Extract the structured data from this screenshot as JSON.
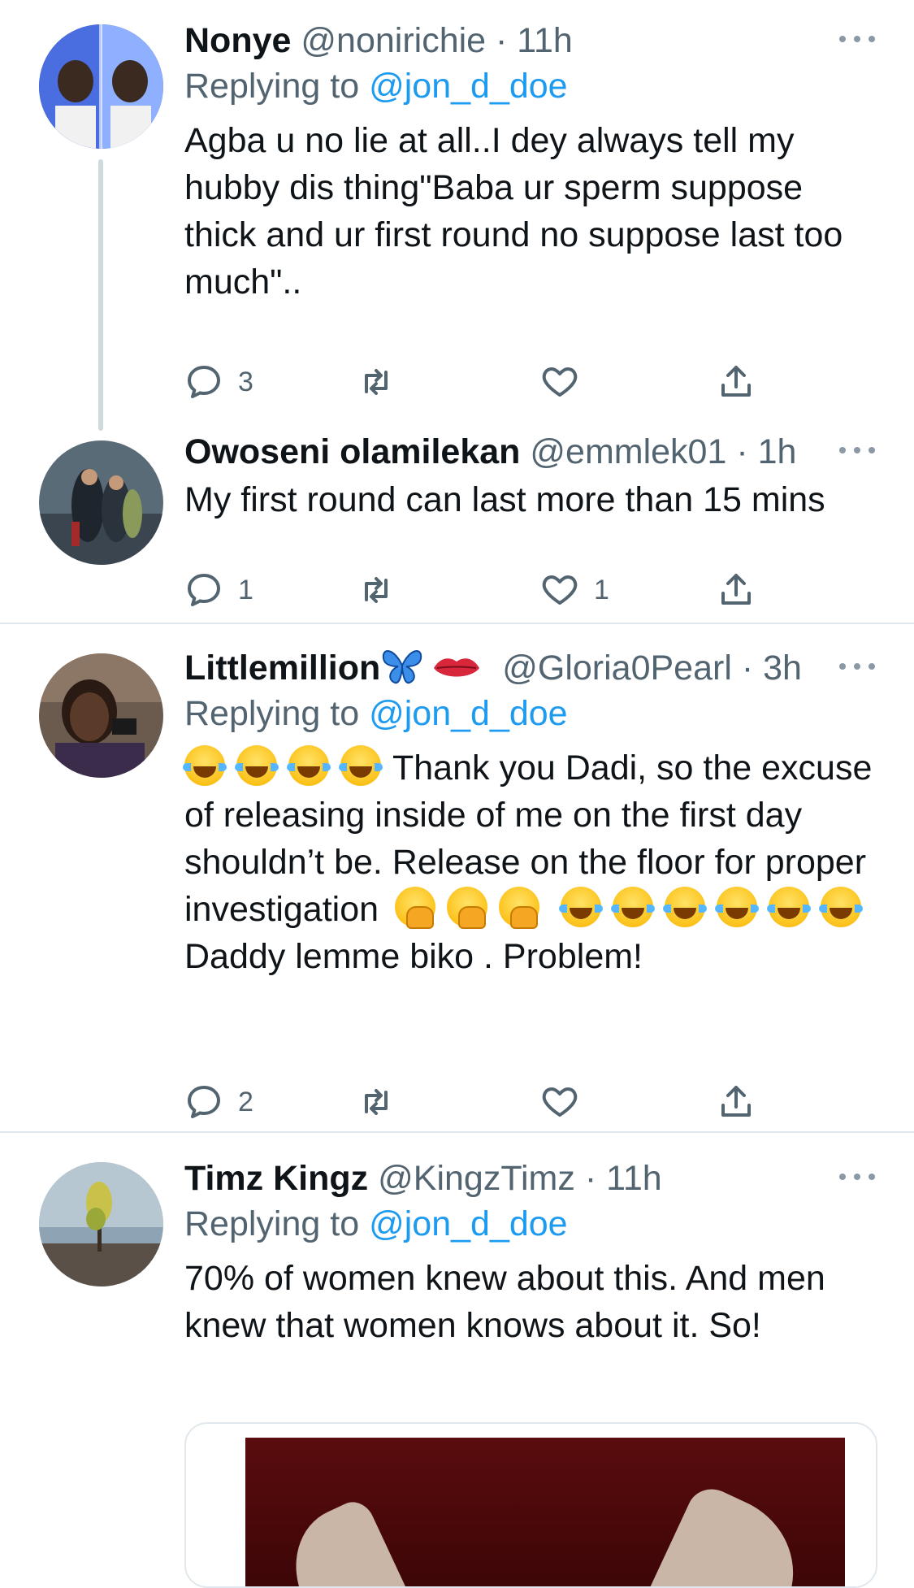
{
  "replies": [
    {
      "name": "Nonye",
      "handle": "@nonirichie",
      "time": "11h",
      "replying_prefix": "Replying to ",
      "replying_to": "@jon_d_doe",
      "text": "Agba u no lie at all..I dey always tell my hubby dis thing\"Baba ur sperm suppose thick and ur first round no suppose last too much\"..",
      "replies_count": "3",
      "retweets_count": "",
      "likes_count": ""
    },
    {
      "name": "Owoseni olamilekan",
      "handle": "@emmlek01",
      "time": "1h",
      "text": "My first round can last more than 15 mins",
      "replies_count": "1",
      "retweets_count": "",
      "likes_count": "1"
    },
    {
      "name": "Littlemillion",
      "handle": "@Gloria0Pearl",
      "time": "3h",
      "replying_prefix": "Replying to ",
      "replying_to": "@jon_d_doe",
      "text_part1": "Thank you Dadi, so the excuse of releasing inside of me on the first day shouldn’t be. Release on the floor for proper investigation",
      "text_part2": "Daddy lemme biko . Problem!",
      "replies_count": "2",
      "retweets_count": "",
      "likes_count": ""
    },
    {
      "name": "Timz Kingz",
      "handle": "@KingzTimz",
      "time": "11h",
      "replying_prefix": "Replying to ",
      "replying_to": "@jon_d_doe",
      "text": "70% of women knew about this. And men knew that women knows about it. So!",
      "replies_count": "",
      "retweets_count": "",
      "likes_count": ""
    }
  ],
  "separator": " · ",
  "colors": {
    "link": "#1d9bf0",
    "secondary": "#536471",
    "divider": "#e1e8ed"
  },
  "icons": [
    "reply-icon",
    "retweet-icon",
    "like-icon",
    "share-icon",
    "more-icon",
    "butterfly-emoji",
    "lips-emoji",
    "laughing-tears-emoji",
    "hand-over-mouth-emoji"
  ]
}
